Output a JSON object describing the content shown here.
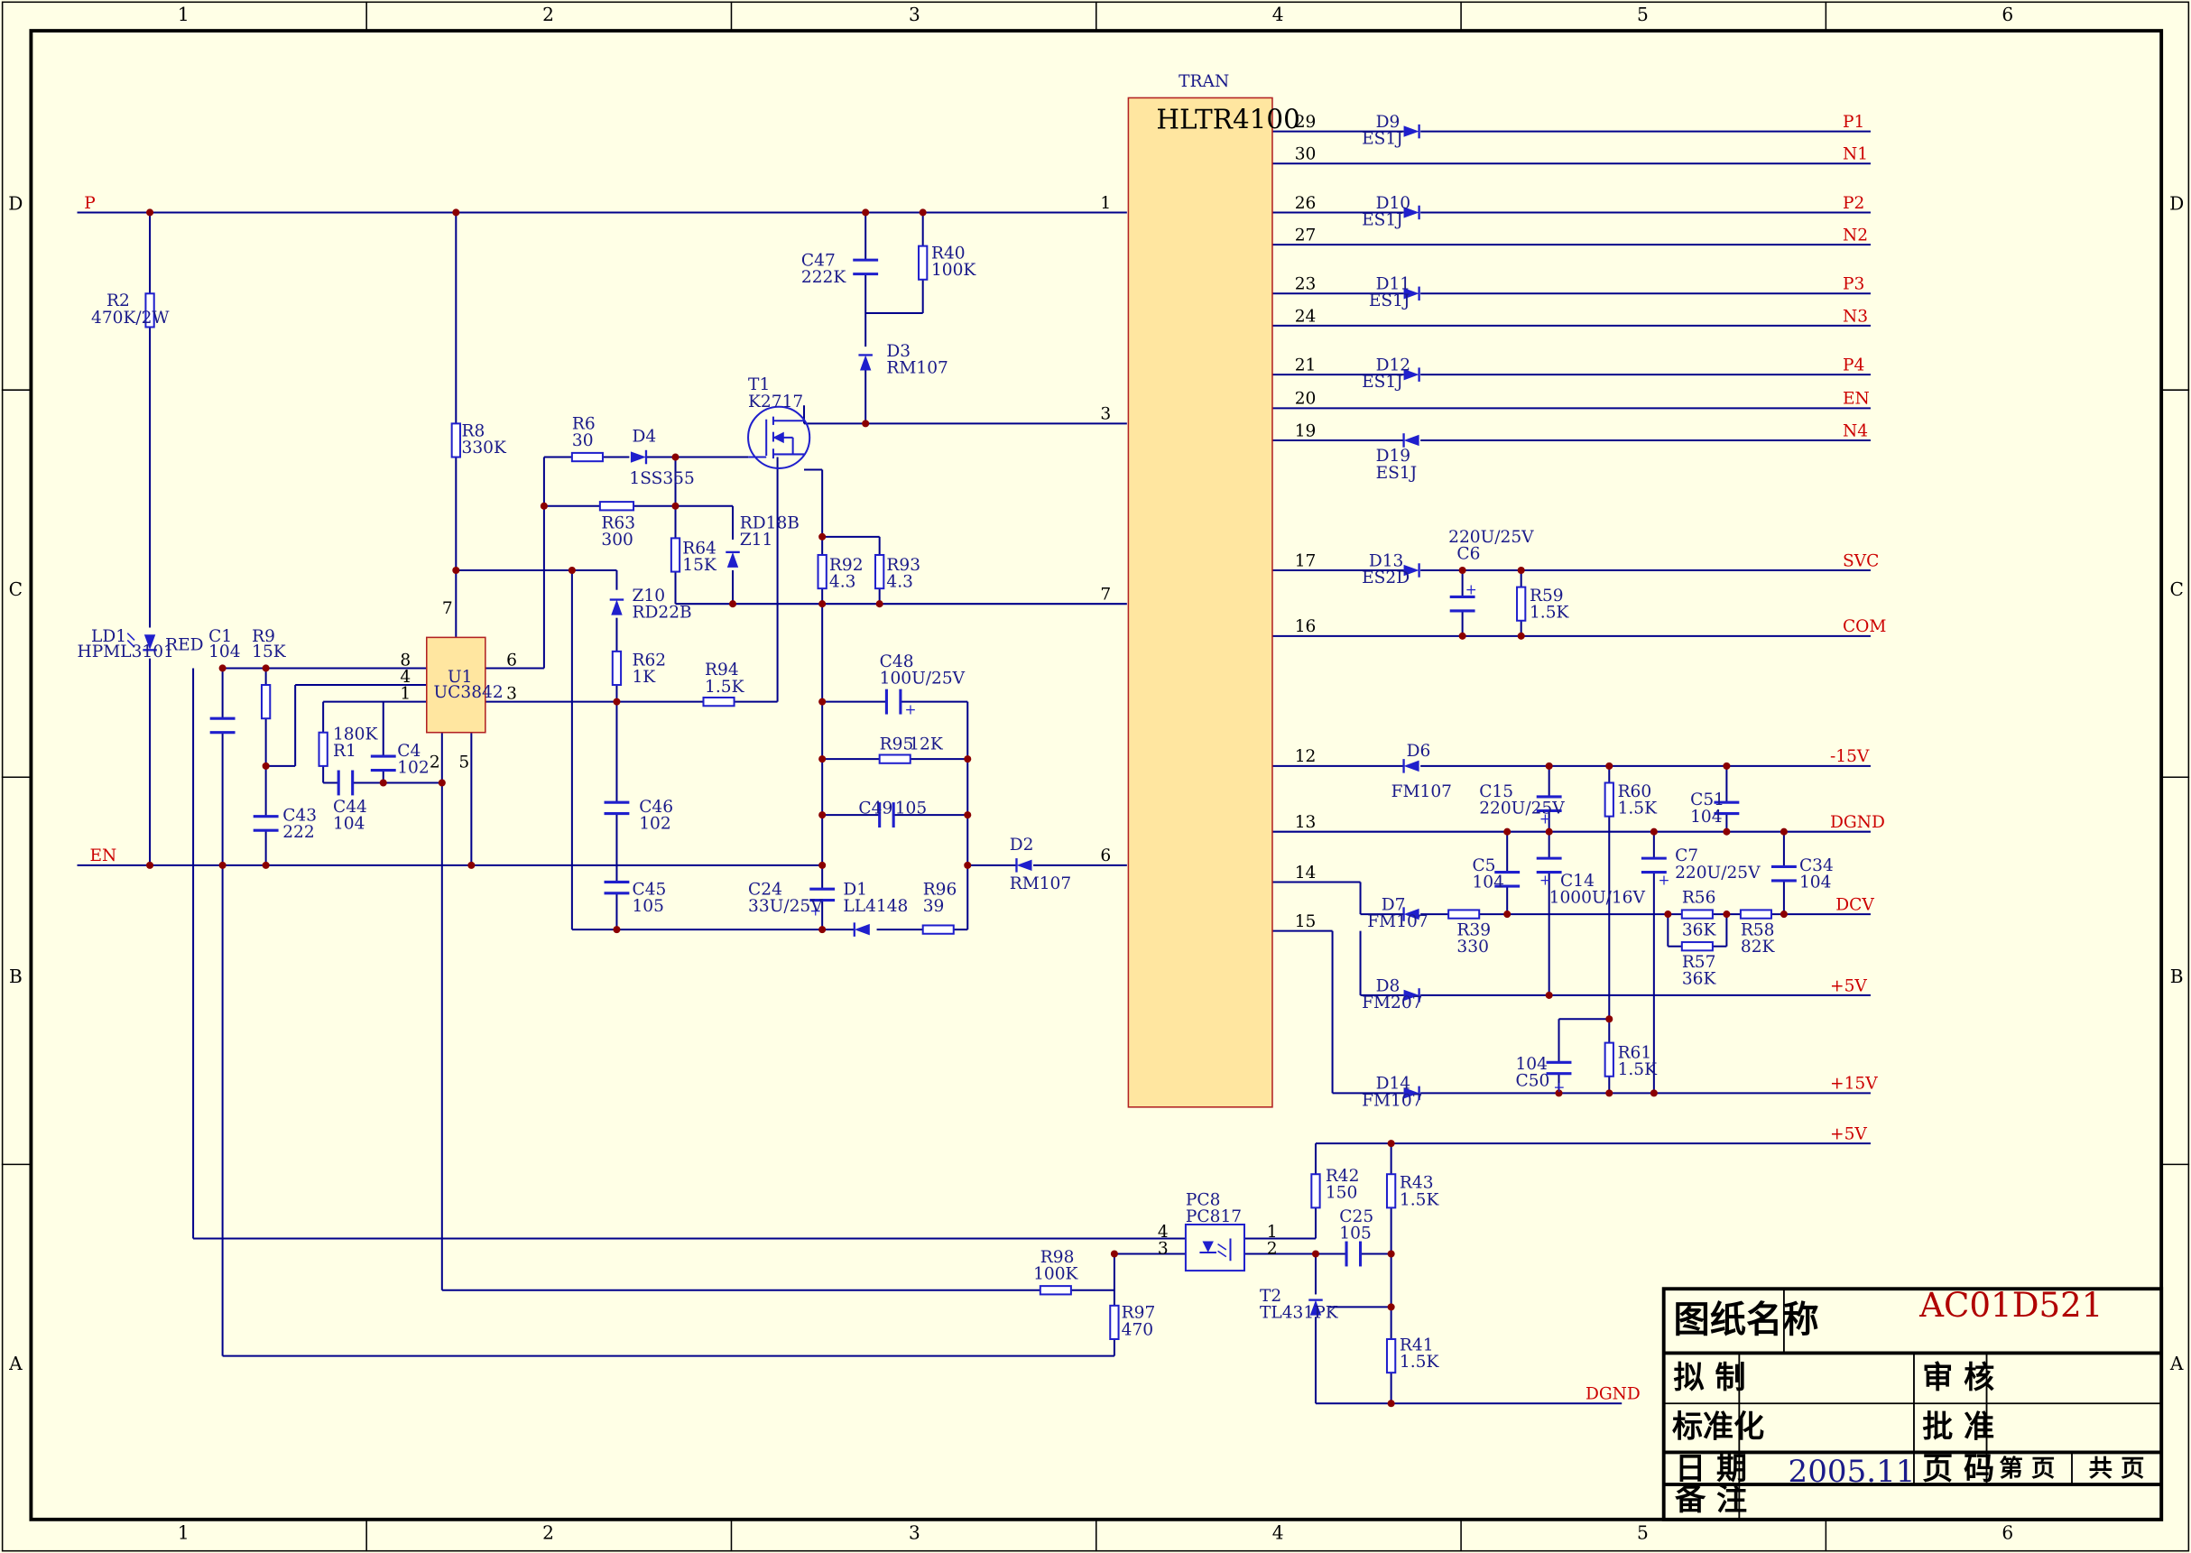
{
  "title_block": {
    "drawing_name_label": "图纸名称",
    "drawing_name": "AC01D521",
    "drawn_label": "拟 制",
    "review_label": "审 核",
    "standard_label": "标准化",
    "approve_label": "批 准",
    "date_label": "日 期",
    "date": "2005.11",
    "page_label": "页 码",
    "page_no_label": "第 页",
    "total_label": "共 页",
    "remarks_label": "备 注"
  },
  "frame": {
    "col_labels": [
      "1",
      "2",
      "3",
      "4",
      "5",
      "6"
    ],
    "row_labels": [
      "D",
      "C",
      "B",
      "A"
    ]
  },
  "transformer": {
    "ref": "TRAN",
    "name": "HLTR4100"
  },
  "ic": {
    "ref": "U1",
    "value": "UC3842"
  },
  "nets": {
    "p": "P",
    "en": "EN",
    "p1": "P1",
    "n1": "N1",
    "p2": "P2",
    "n2": "N2",
    "p3": "P3",
    "n3": "N3",
    "p4": "P4",
    "en_out": "EN",
    "n4": "N4",
    "svc": "SVC",
    "com": "COM",
    "m15v": "-15V",
    "dgnd": "DGND",
    "dcv": "DCV",
    "p5v": "+5V",
    "p15v": "+15V",
    "p5v2": "+5V",
    "dgnd2": "DGND"
  },
  "components": {
    "r2": "R2",
    "r2_val": "470K/2W",
    "ld1": "LD1",
    "ld1_val": "HPML3101",
    "ld1_color": "RED",
    "c1": "C1",
    "c1_val": "104",
    "r9": "R9",
    "r9_val": "15K",
    "c43": "C43",
    "c43_val": "222",
    "r1": "R1",
    "r1_val": "180K",
    "c44": "C44",
    "c44_val": "104",
    "c4": "C4",
    "c4_val": "102",
    "r8": "R8",
    "r8_val": "330K",
    "r6": "R6",
    "r6_val": "30",
    "d4": "D4",
    "d4_val": "1SS355",
    "r63": "R63",
    "r63_val": "300",
    "r64": "R64",
    "r64_val": "15K",
    "z11": "Z11",
    "z11_val": "RD18B",
    "z10": "Z10",
    "z10_val": "RD22B",
    "r62": "R62",
    "r62_val": "1K",
    "c46": "C46",
    "c46_val": "102",
    "c45": "C45",
    "c45_val": "105",
    "t1": "T1",
    "t1_val": "K2717",
    "c47": "C47",
    "c47_val": "222K",
    "r40": "R40",
    "r40_val": "100K",
    "d3": "D3",
    "d3_val": "RM107",
    "r92": "R92",
    "r92_val": "4.3",
    "r93": "R93",
    "r93_val": "4.3",
    "r94": "R94",
    "r94_val": "1.5K",
    "c48": "C48",
    "c48_val": "100U/25V",
    "r95": "R95",
    "r95_val": "12K",
    "c49": "C49",
    "c49_val": "105",
    "c24": "C24",
    "c24_val": "33U/25V",
    "d1": "D1",
    "d1_val": "LL4148",
    "r96": "R96",
    "r96_val": "39",
    "d2": "D2",
    "d2_val": "RM107",
    "d9": "D9",
    "d9_val": "ES1J",
    "d10": "D10",
    "d10_val": "ES1J",
    "d11": "D11",
    "d11_val": "ES1J",
    "d12": "D12",
    "d12_val": "ES1J",
    "d19": "D19",
    "d19_val": "ES1J",
    "d13": "D13",
    "d13_val": "ES2D",
    "c6": "C6",
    "c6_val": "220U/25V",
    "r59": "R59",
    "r59_val": "1.5K",
    "d6": "D6",
    "d6_val": "FM107",
    "c15": "C15",
    "c15_val": "220U/25V",
    "r60": "R60",
    "r60_val": "1.5K",
    "c51": "C51",
    "c51_val": "104",
    "c5": "C5",
    "c5_val": "104",
    "c14": "C14",
    "c14_val": "1000U/16V",
    "c7": "C7",
    "c7_val": "220U/25V",
    "c34": "C34",
    "c34_val": "104",
    "d7": "D7",
    "d7_val": "FM107",
    "r39": "R39",
    "r39_val": "330",
    "r56": "R56",
    "r56_val": "36K",
    "r58": "R58",
    "r58_val": "82K",
    "r57": "R57",
    "r57_val": "36K",
    "d8": "D8",
    "d8_val": "FM207",
    "c50": "C50",
    "c50_val": "104",
    "r61": "R61",
    "r61_val": "1.5K",
    "d14": "D14",
    "d14_val": "FM107",
    "pc8": "PC8",
    "pc8_val": "PC817",
    "r42": "R42",
    "r42_val": "150",
    "r43": "R43",
    "r43_val": "1.5K",
    "c25": "C25",
    "c25_val": "105",
    "t2": "T2",
    "t2_val": "TL431PK",
    "r41": "R41",
    "r41_val": "1.5K",
    "r98": "R98",
    "r98_val": "100K",
    "r97": "R97",
    "r97_val": "470"
  },
  "pins": {
    "u1": [
      "8",
      "4",
      "1",
      "7",
      "6",
      "3",
      "2",
      "5"
    ],
    "tran_primary": [
      "1",
      "3",
      "7",
      "6"
    ],
    "tran_secondary": [
      "29",
      "30",
      "26",
      "27",
      "23",
      "24",
      "21",
      "20",
      "19",
      "17",
      "16",
      "12",
      "13",
      "14",
      "15"
    ],
    "pc8": [
      "4",
      "3",
      "1",
      "2"
    ]
  },
  "colors": {
    "background": "#FFFFE6",
    "wire": "#00008B",
    "component": "#1F1FCC",
    "junction": "#8B0000",
    "net_label": "#CC0000",
    "chip_fill": "#FFE6A0",
    "chip_border": "#B22222"
  }
}
